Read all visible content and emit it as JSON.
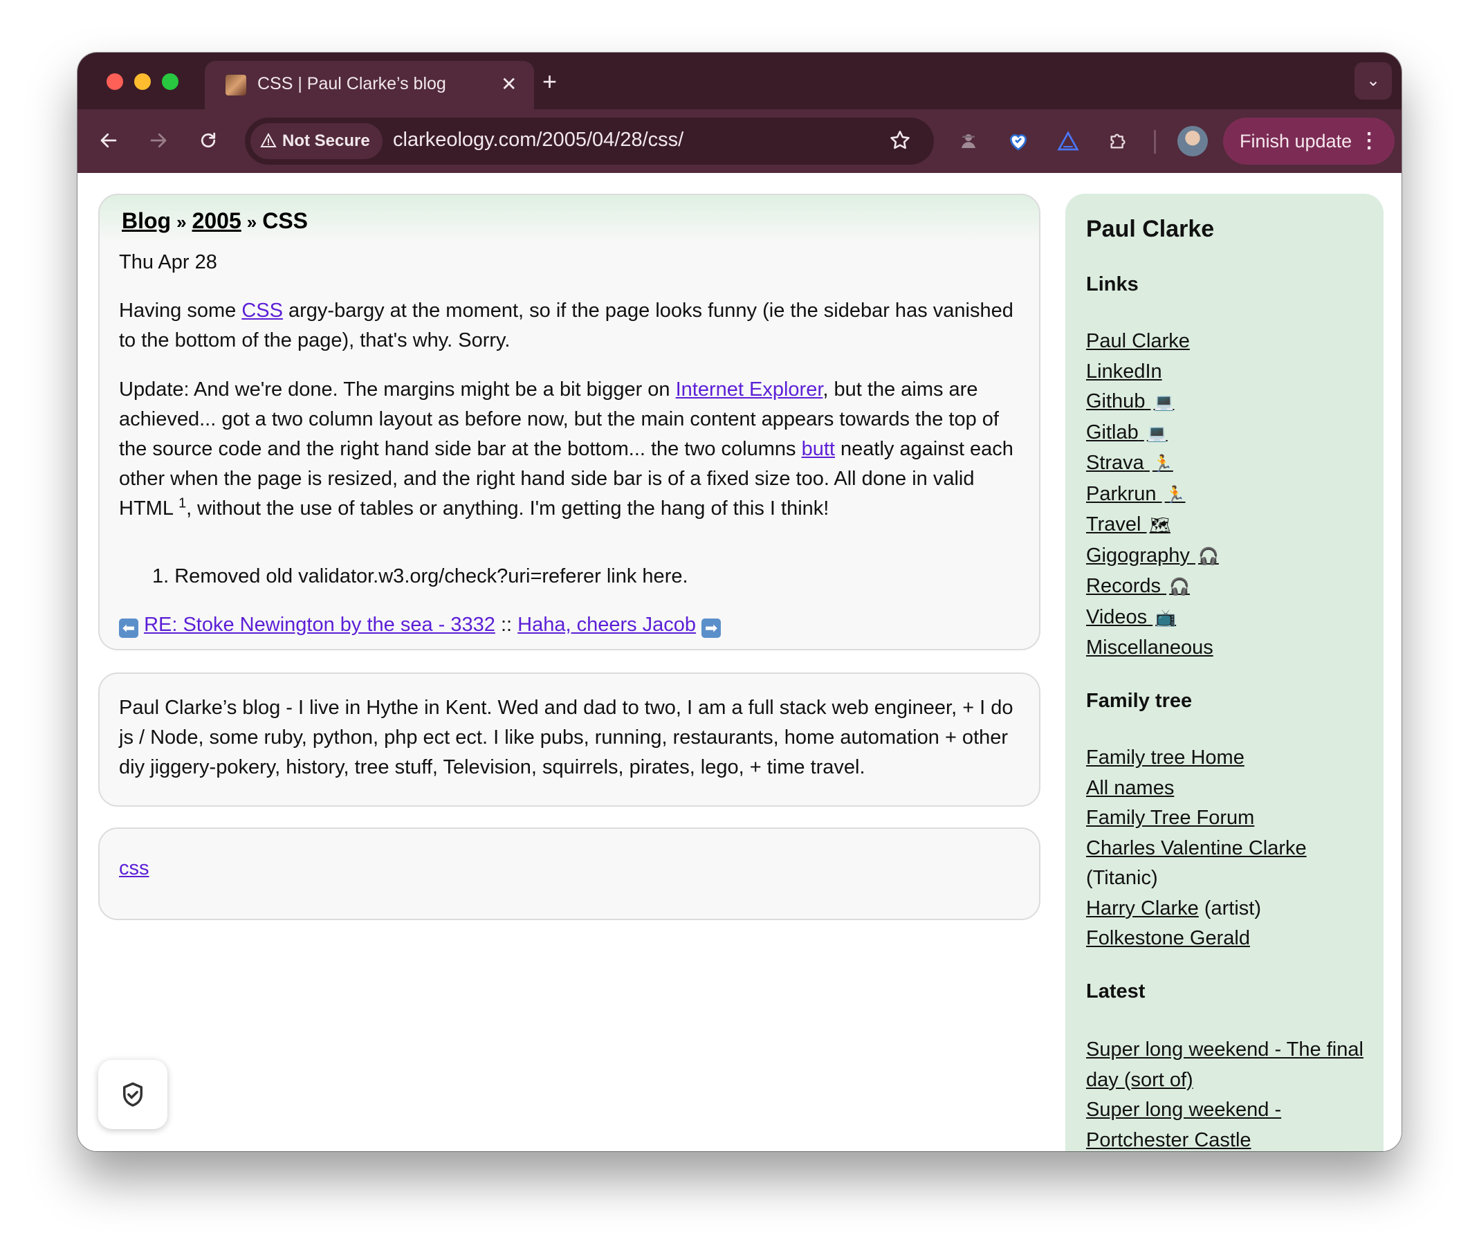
{
  "browser": {
    "tab_title": "CSS | Paul Clarke’s blog",
    "tab_close": "✕",
    "new_tab": "+",
    "tab_search": "⌄",
    "not_secure_label": "Not Secure",
    "url": "clarkeology.com/2005/04/28/css/",
    "finish_update_label": "Finish update"
  },
  "post": {
    "breadcrumb": [
      "Blog",
      "2005",
      "CSS"
    ],
    "breadcrumb_sep": "»",
    "date": "Thu Apr 28",
    "p1_pre": "Having some ",
    "p1_link": "CSS",
    "p1_post": " argy-bargy at the moment, so if the page looks funny (ie the sidebar has vanished to the bottom of the page), that's why. Sorry.",
    "p2_pre": "Update: And we're done. The margins might be a bit bigger on ",
    "p2_link1": "Internet Explorer",
    "p2_mid": ", but the aims are achieved... got a two column layout as before now, but the main content appears towards the top of the source code and the right hand side bar at the bottom... the two columns ",
    "p2_link2": "butt",
    "p2_mid2": " neatly against each other when the page is resized, and the right hand side bar is of a fixed size too. All done in valid HTML",
    "p2_sup": "1",
    "p2_post": ", without the use of tables or anything. I'm getting the hang of this I think!",
    "footnote": "1. Removed old validator.w3.org/check?uri=referer link here.",
    "prev_link": "RE: Stoke Newington by the sea - 3332",
    "nav_sep": "::",
    "next_link": "Haha, cheers Jacob"
  },
  "about": {
    "text": "Paul Clarke’s blog - I live in Hythe in Kent. Wed and dad to two, I am a full stack web engineer, + I do js / Node, some ruby, python, php ect ect. I like pubs, running, restaurants, home automation + other diy jiggery-pokery, history, tree stuff, Television, squirrels, pirates, lego, + time travel."
  },
  "tags": {
    "tag1": "css"
  },
  "sidebar": {
    "title": "Paul Clarke",
    "links_heading": "Links",
    "links": [
      {
        "label": "Paul Clarke",
        "emoji": ""
      },
      {
        "label": "LinkedIn",
        "emoji": ""
      },
      {
        "label": "Github",
        "emoji": "💻"
      },
      {
        "label": "Gitlab",
        "emoji": "💻"
      },
      {
        "label": "Strava",
        "emoji": "🏃"
      },
      {
        "label": "Parkrun",
        "emoji": "🏃"
      },
      {
        "label": "Travel",
        "emoji": "🗺"
      },
      {
        "label": "Gigography",
        "emoji": "🎧"
      },
      {
        "label": "Records",
        "emoji": "🎧"
      },
      {
        "label": "Videos",
        "emoji": "📺"
      },
      {
        "label": "Miscellaneous",
        "emoji": ""
      }
    ],
    "family_heading": "Family tree",
    "family": {
      "home": "Family tree Home",
      "names": "All names",
      "forum": "Family Tree Forum",
      "charles": "Charles Valentine Clarke",
      "charles_note": "(Titanic)",
      "harry": "Harry Clarke",
      "harry_note": "(artist)",
      "gerald": "Folkestone Gerald"
    },
    "latest_heading": "Latest",
    "latest": [
      "Super long weekend - The final day (sort of)",
      "Super long weekend - Portchester Castle"
    ]
  },
  "colors": {
    "accent_link": "#5b1fd6",
    "chrome_frame": "#3a1c28",
    "chrome_toolbar": "#522a3b",
    "update_button": "#7c2c54",
    "sidebar_bg": "#dceddf"
  },
  "icons": {
    "back": "arrow-left-icon",
    "forward": "arrow-right-icon",
    "reload": "reload-icon",
    "warning": "warning-triangle-icon",
    "bookmark": "star-icon",
    "extensions": [
      "spy-icon",
      "heart-shield-icon",
      "triangle-logo-icon",
      "puzzle-icon"
    ],
    "menu": "vertical-dots-icon",
    "privacy": "shield-check-icon"
  }
}
